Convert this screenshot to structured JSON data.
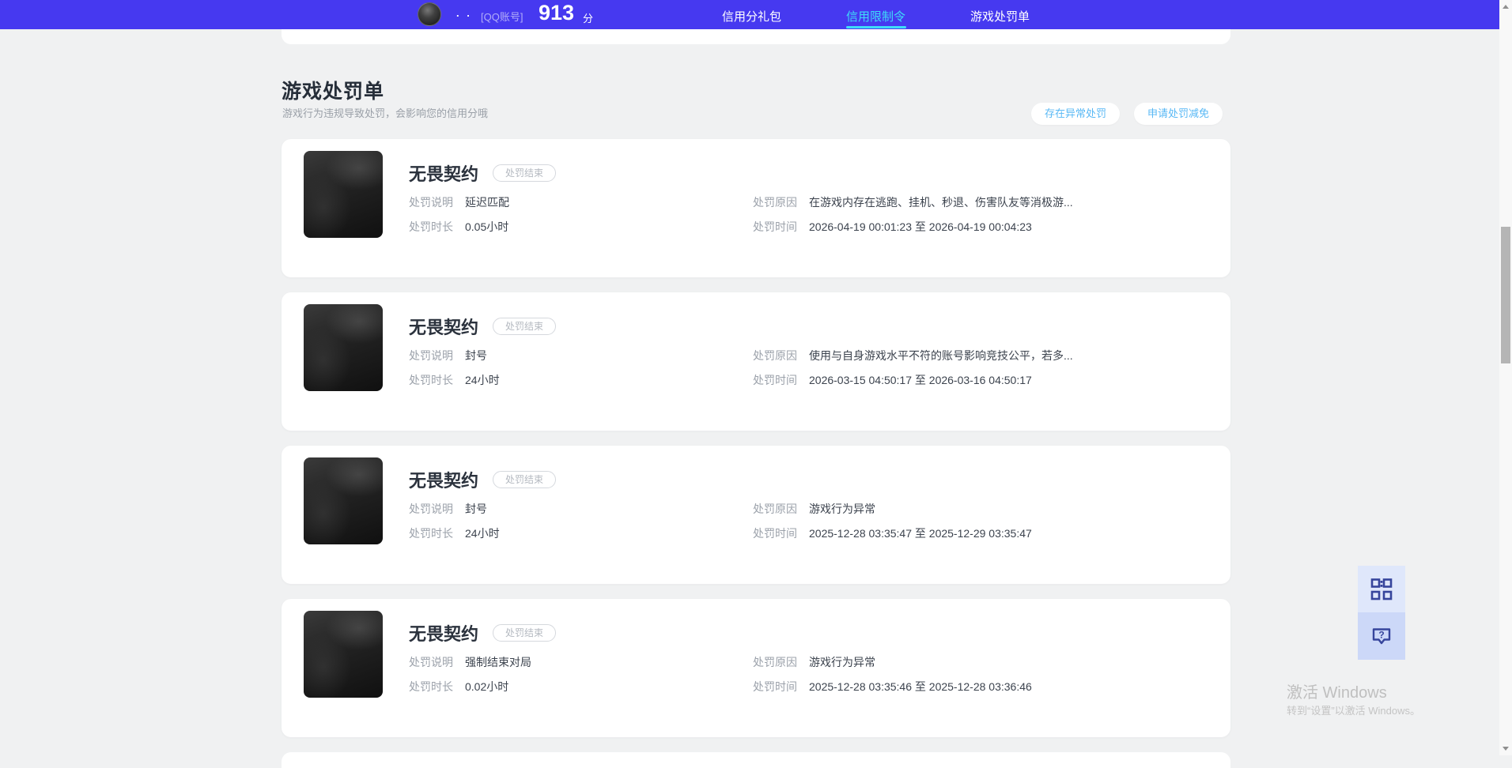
{
  "colors": {
    "header_bg": "#4639f0",
    "active_tab": "#3edcf8",
    "action_button_text": "#58b8f5",
    "page_bg": "#f0f1f2",
    "float_icon": "#36459c"
  },
  "header": {
    "username": ". .",
    "account_label": "[QQ账号]",
    "score": "913",
    "score_unit": "分",
    "nav": [
      {
        "label": "信用分礼包",
        "active": false
      },
      {
        "label": "信用限制令",
        "active": true
      },
      {
        "label": "游戏处罚单",
        "active": false
      }
    ]
  },
  "page": {
    "title": "游戏处罚单",
    "subtitle": "游戏行为违规导致处罚，会影响您的信用分哦",
    "actions": [
      {
        "label": "存在异常处罚"
      },
      {
        "label": "申请处罚减免"
      }
    ]
  },
  "field_labels": {
    "desc": "处罚说明",
    "duration": "处罚时长",
    "reason": "处罚原因",
    "time": "处罚时间"
  },
  "cards": [
    {
      "game": "无畏契约",
      "status": "处罚结束",
      "desc": "延迟匹配",
      "duration": "0.05小时",
      "reason": "在游戏内存在逃跑、挂机、秒退、伤害队友等消极游...",
      "time": "2026-04-19 00:01:23 至 2026-04-19 00:04:23"
    },
    {
      "game": "无畏契约",
      "status": "处罚结束",
      "desc": "封号",
      "duration": "24小时",
      "reason": "使用与自身游戏水平不符的账号影响竞技公平，若多...",
      "time": "2026-03-15 04:50:17 至 2026-03-16 04:50:17"
    },
    {
      "game": "无畏契约",
      "status": "处罚结束",
      "desc": "封号",
      "duration": "24小时",
      "reason": "游戏行为异常",
      "time": "2025-12-28 03:35:47 至 2025-12-29 03:35:47"
    },
    {
      "game": "无畏契约",
      "status": "处罚结束",
      "desc": "强制结束对局",
      "duration": "0.02小时",
      "reason": "游戏行为异常",
      "time": "2025-12-28 03:35:46 至 2025-12-28 03:36:46"
    }
  ],
  "floating": {
    "help_glyph": "?"
  },
  "watermark": {
    "line1": "激活 Windows",
    "line2": "转到“设置”以激活 Windows。"
  }
}
